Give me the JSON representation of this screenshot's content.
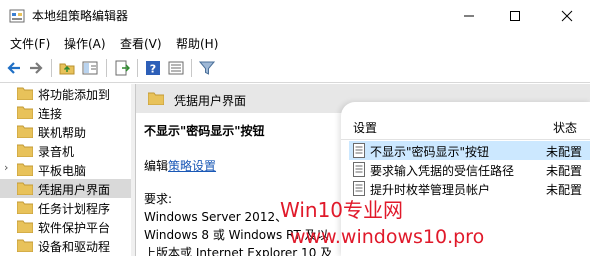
{
  "window": {
    "title": "本地组策略编辑器"
  },
  "menu": [
    "文件(F)",
    "操作(A)",
    "查看(V)",
    "帮助(H)"
  ],
  "toolbar_icons": [
    "back-arrow-icon",
    "forward-arrow-icon",
    "up-folder-icon",
    "show-hide-tree-icon",
    "export-list-icon",
    "help-icon",
    "details-view-icon",
    "filter-icon"
  ],
  "tree": {
    "items": [
      {
        "label": "将功能添加到",
        "selected": false
      },
      {
        "label": "连接",
        "selected": false
      },
      {
        "label": "联机帮助",
        "selected": false
      },
      {
        "label": "录音机",
        "selected": false
      },
      {
        "label": "平板电脑",
        "selected": false,
        "collapsed": true
      },
      {
        "label": "凭据用户界面",
        "selected": true
      },
      {
        "label": "任务计划程序",
        "selected": false
      },
      {
        "label": "软件保护平台",
        "selected": false
      },
      {
        "label": "设备和驱动程",
        "selected": false
      }
    ]
  },
  "right_header": {
    "label": "凭据用户界面"
  },
  "description": {
    "title": "不显示\"密码显示\"按钮",
    "edit_prefix": "编辑",
    "edit_link": "策略设置",
    "requirements_label": "要求:",
    "requirements_lines": [
      "Windows Server 2012、",
      "Windows 8 或 Windows RT 及以",
      "上版本或 Internet Explorer 10 及"
    ]
  },
  "settings_list": {
    "col_setting": "设置",
    "col_state": "状态",
    "rows": [
      {
        "name": "不显示\"密码显示\"按钮",
        "state": "未配置",
        "selected": true
      },
      {
        "name": "要求输入凭据的受信任路径",
        "state": "未配置",
        "selected": false
      },
      {
        "name": "提升时枚举管理员帐户",
        "state": "未配置",
        "selected": false
      }
    ]
  },
  "watermark": {
    "line1": "Win10专业网",
    "line2": "www.windows10.pro"
  },
  "colors": {
    "accent_folder": "#e8c25a",
    "link": "#1a58b6",
    "selection": "#cce8ff",
    "tree_selection": "#d9d9d9",
    "watermark": "#e0192a"
  }
}
